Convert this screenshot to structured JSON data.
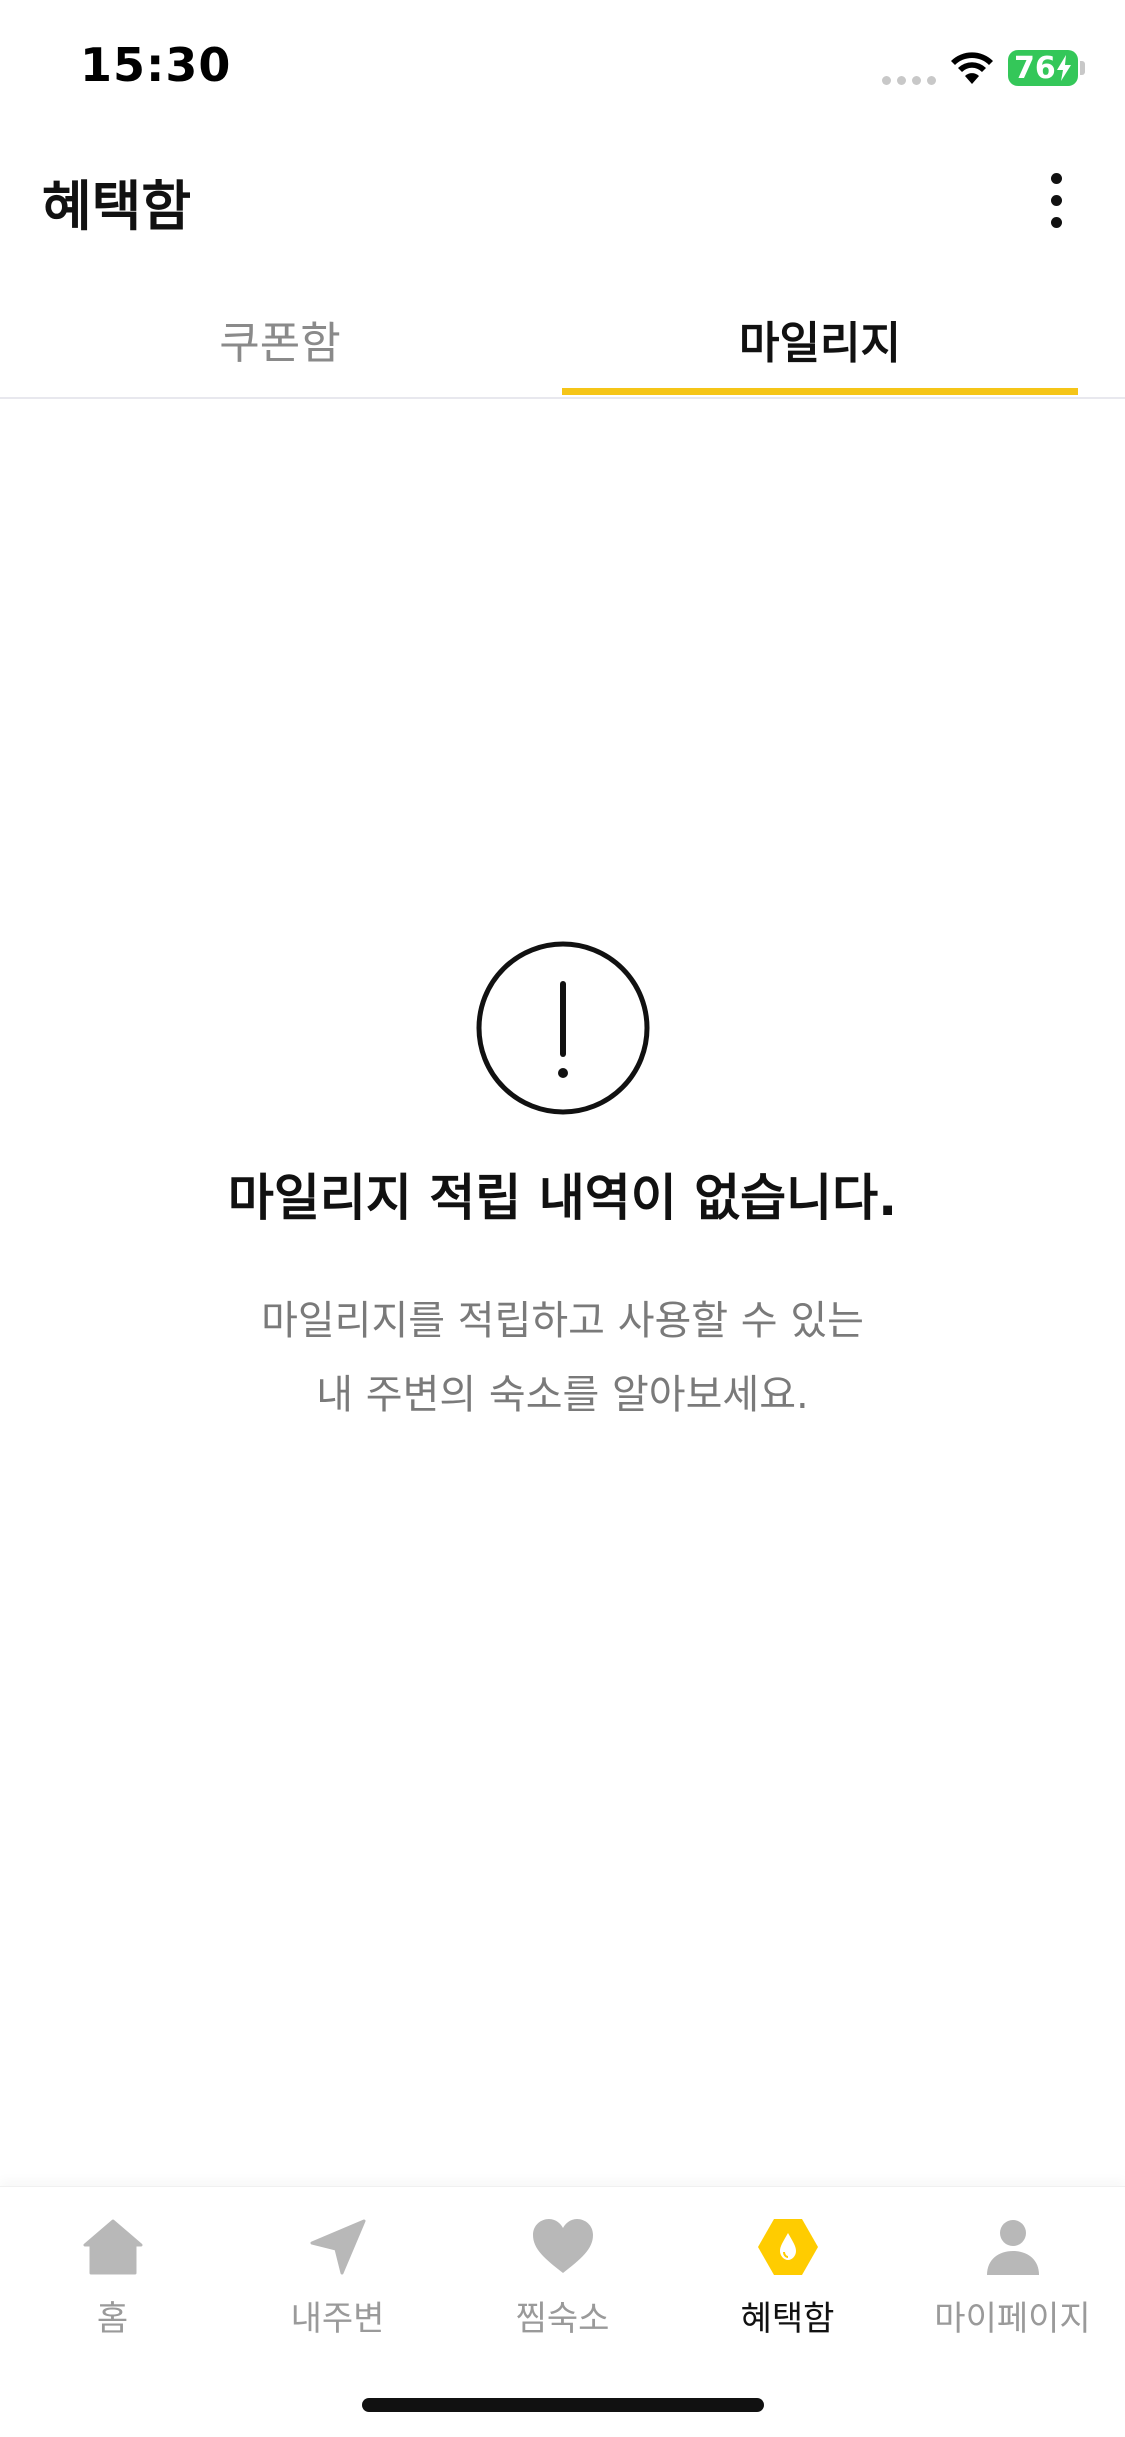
{
  "status_bar": {
    "time": "15:30",
    "battery_level": "76",
    "wifi_icon": "wifi-icon",
    "battery_icon": "battery-charging-icon",
    "battery_color": "#34c759"
  },
  "header": {
    "title": "혜택함",
    "more_icon": "more-vertical-icon"
  },
  "tabs": {
    "items": [
      {
        "label": "쿠폰함",
        "active": false
      },
      {
        "label": "마일리지",
        "active": true
      }
    ],
    "active_color": "#f5c518"
  },
  "empty_state": {
    "icon": "alert-circle-icon",
    "title": "마일리지 적립 내역이 없습니다.",
    "description_line1": "마일리지를 적립하고 사용할 수 있는",
    "description_line2": "내 주변의 숙소를 알아보세요."
  },
  "bottom_nav": {
    "items": [
      {
        "label": "홈",
        "icon": "home-icon",
        "active": false
      },
      {
        "label": "내주변",
        "icon": "navigation-icon",
        "active": false
      },
      {
        "label": "찜숙소",
        "icon": "heart-icon",
        "active": false
      },
      {
        "label": "혜택함",
        "icon": "benefit-hexagon-icon",
        "active": true
      },
      {
        "label": "마이페이지",
        "icon": "user-icon",
        "active": false
      }
    ],
    "active_icon_color": "#ffcc00",
    "inactive_color": "#b8b8b8"
  }
}
